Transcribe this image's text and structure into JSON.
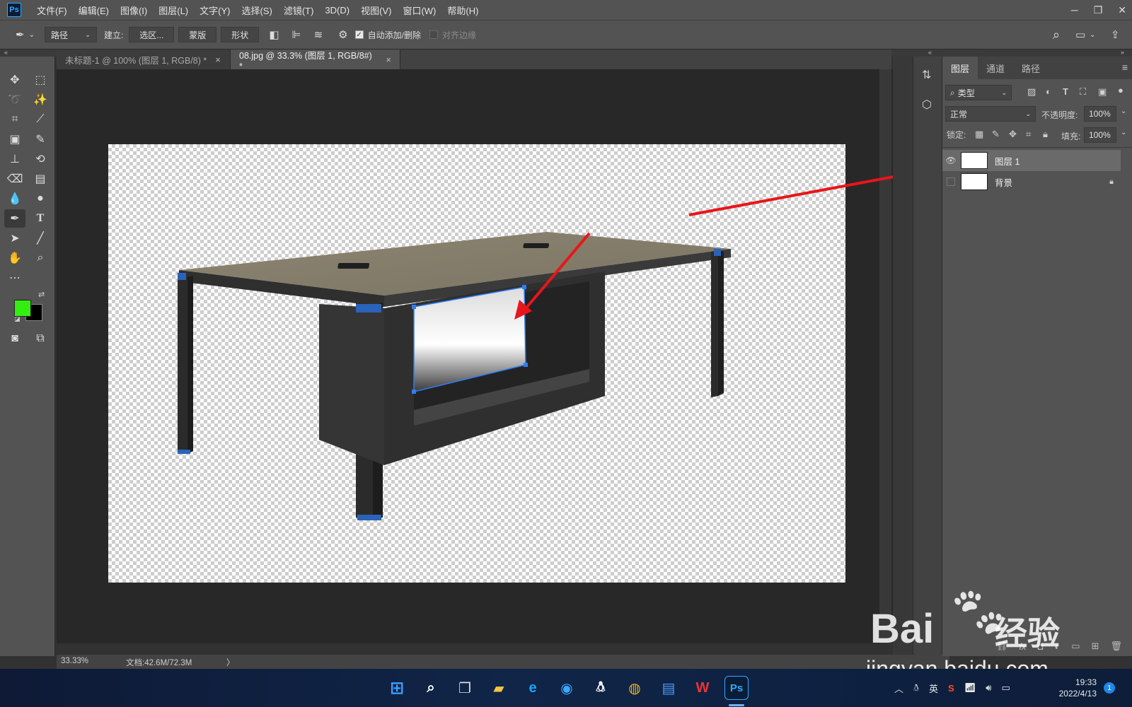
{
  "app": {
    "logo": "Ps"
  },
  "menu": [
    "文件(F)",
    "编辑(E)",
    "图像(I)",
    "图层(L)",
    "文字(Y)",
    "选择(S)",
    "滤镜(T)",
    "3D(D)",
    "视图(V)",
    "窗口(W)",
    "帮助(H)"
  ],
  "options": {
    "mode_select": "路径",
    "make_label": "建立:",
    "selection_btn": "选区...",
    "mask_btn": "蒙版",
    "shape_btn": "形状",
    "auto_add_delete": "自动添加/删除",
    "align_edges": "对齐边缘"
  },
  "tabs": [
    {
      "label": "未标题-1 @ 100% (图层 1, RGB/8) *",
      "close": "×"
    },
    {
      "label": "08.jpg @ 33.3% (图层 1, RGB/8#) *",
      "close": "×"
    }
  ],
  "status": {
    "zoom": "33.33%",
    "doc": "文档:42.6M/72.3M",
    "arrow": "〉"
  },
  "colors": {
    "foreground": "#33ee11",
    "background": "#000000",
    "annotation_arrow": "#e8161a",
    "selection": "#2f7cf6"
  },
  "layers_panel": {
    "tabs": [
      "图层",
      "通道",
      "路径"
    ],
    "filter_select": "类型",
    "blend_mode": "正常",
    "opacity_label": "不透明度:",
    "opacity_value": "100%",
    "lock_label": "锁定:",
    "fill_label": "填充:",
    "fill_value": "100%",
    "layers": [
      {
        "name": "图层 1",
        "visible": true,
        "selected": true
      },
      {
        "name": "背景",
        "visible": false,
        "locked": true
      }
    ]
  },
  "taskbar": {
    "tray_lang": "英",
    "time": "19:33",
    "date": "2022/4/13",
    "notifications": "1"
  },
  "watermark": {
    "brand": "Bai",
    "brand2": "经验",
    "url": "jingyan.baidu.com"
  }
}
